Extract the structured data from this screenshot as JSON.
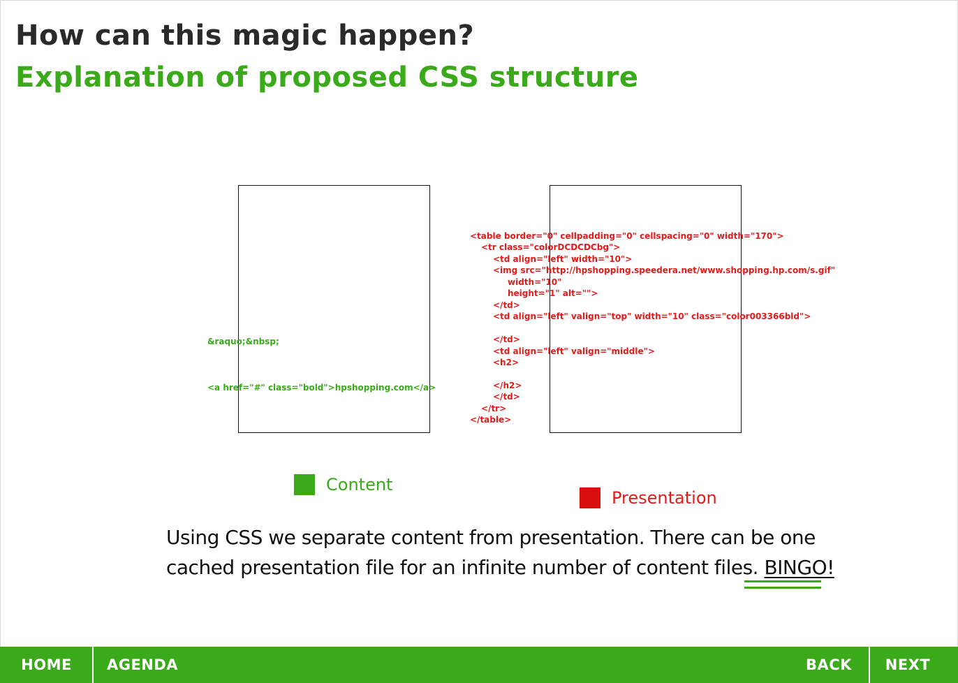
{
  "slide": {
    "title": "How can this magic happen?",
    "subtitle": "Explanation of proposed CSS structure"
  },
  "content_code": [
    "&raquo;&nbsp;",
    "<a href=\"#\" class=\"bold\">hpshopping.com</a>"
  ],
  "presentation_code": [
    "<table border=\"0\" cellpadding=\"0\" cellspacing=\"0\" width=\"170\">",
    "<tr class=\"colorDCDCDCbg\">",
    "<td align=\"left\" width=\"10\">",
    "<img src=\"http://hpshopping.speedera.net/www.shopping.hp.com/s.gif\"",
    "width=\"10\"",
    "height=\"1\" alt=\"\">",
    "</td>",
    "<td align=\"left\" valign=\"top\" width=\"10\" class=\"color003366bld\">",
    "</td>",
    "<td align=\"left\" valign=\"middle\">",
    "<h2>",
    "</h2>",
    "</td>",
    "</tr>",
    "</table>"
  ],
  "legend": {
    "content_label": "Content",
    "presentation_label": "Presentation"
  },
  "body": {
    "text": "Using CSS we separate content from presentation. There can be one cached presentation file for an infinite number of content files. ",
    "highlight": "BINGO!"
  },
  "nav": {
    "home": "HOME",
    "agenda": "AGENDA",
    "back": "BACK",
    "next": "NEXT"
  },
  "colors": {
    "brand_green": "#3aaa1a",
    "presentation_red": "#e31b1b",
    "content_green": "#3aaa1a",
    "title_dark": "#2a2a2a"
  }
}
